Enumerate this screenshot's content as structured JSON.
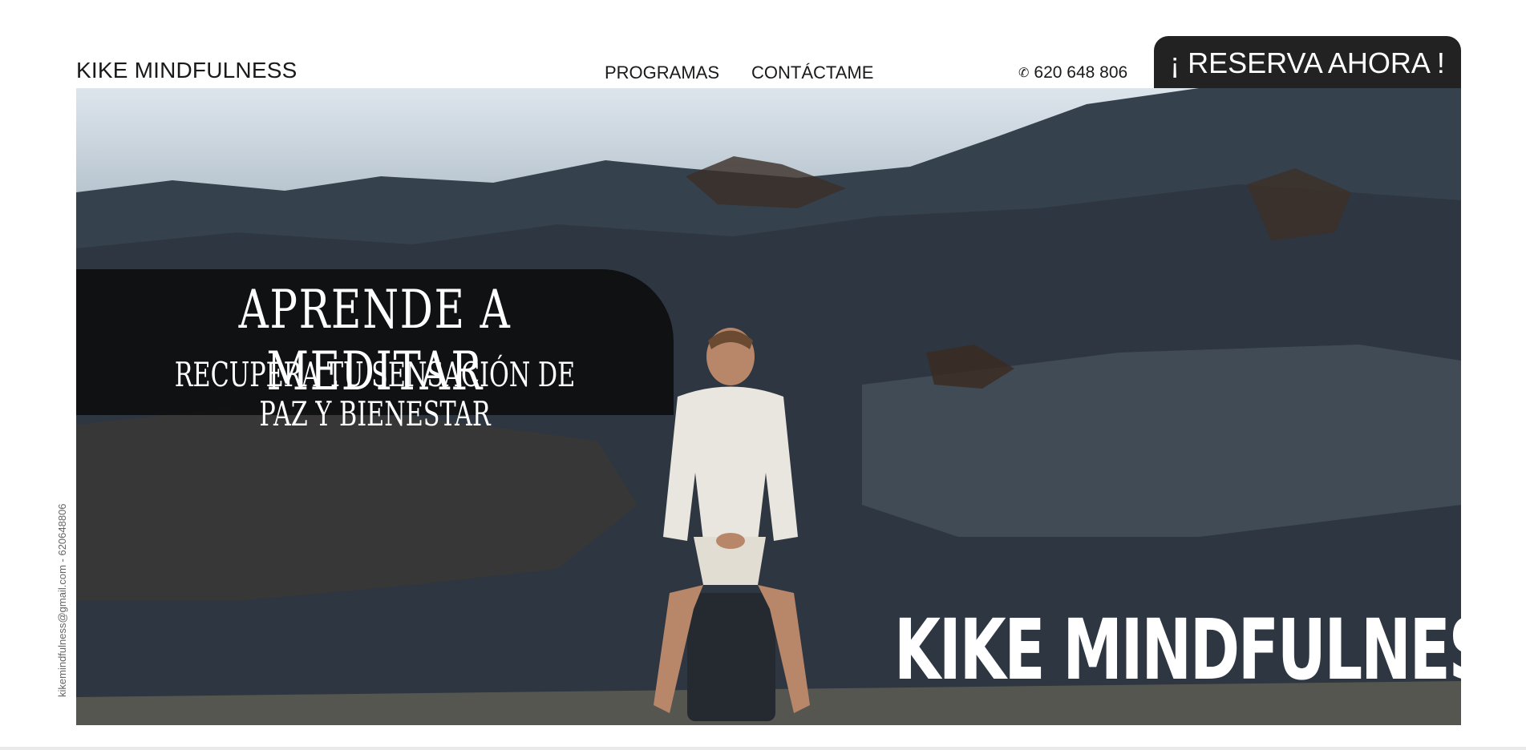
{
  "header": {
    "brand": "KIKE MINDFULNESS",
    "nav": [
      {
        "label": "PROGRAMAS"
      },
      {
        "label": "CONTÁCTAME"
      }
    ],
    "phone": "620 648 806",
    "phone_icon": "whatsapp-icon",
    "reserve_label": "¡ RESERVA AHORA !"
  },
  "hero": {
    "title": "APRENDE A MEDITAR",
    "subtitle": "RECUPERA TU SENSACIÓN DE PAZ Y BIENESTAR",
    "brand_overlay": "KIKE MINDFULNESS"
  },
  "side_contact": "kikemindfulness@gmail.com - 620648806",
  "colors": {
    "button_bg": "#222222",
    "panel_bg": "#0a0a0a",
    "text": "#1a1a1a"
  }
}
